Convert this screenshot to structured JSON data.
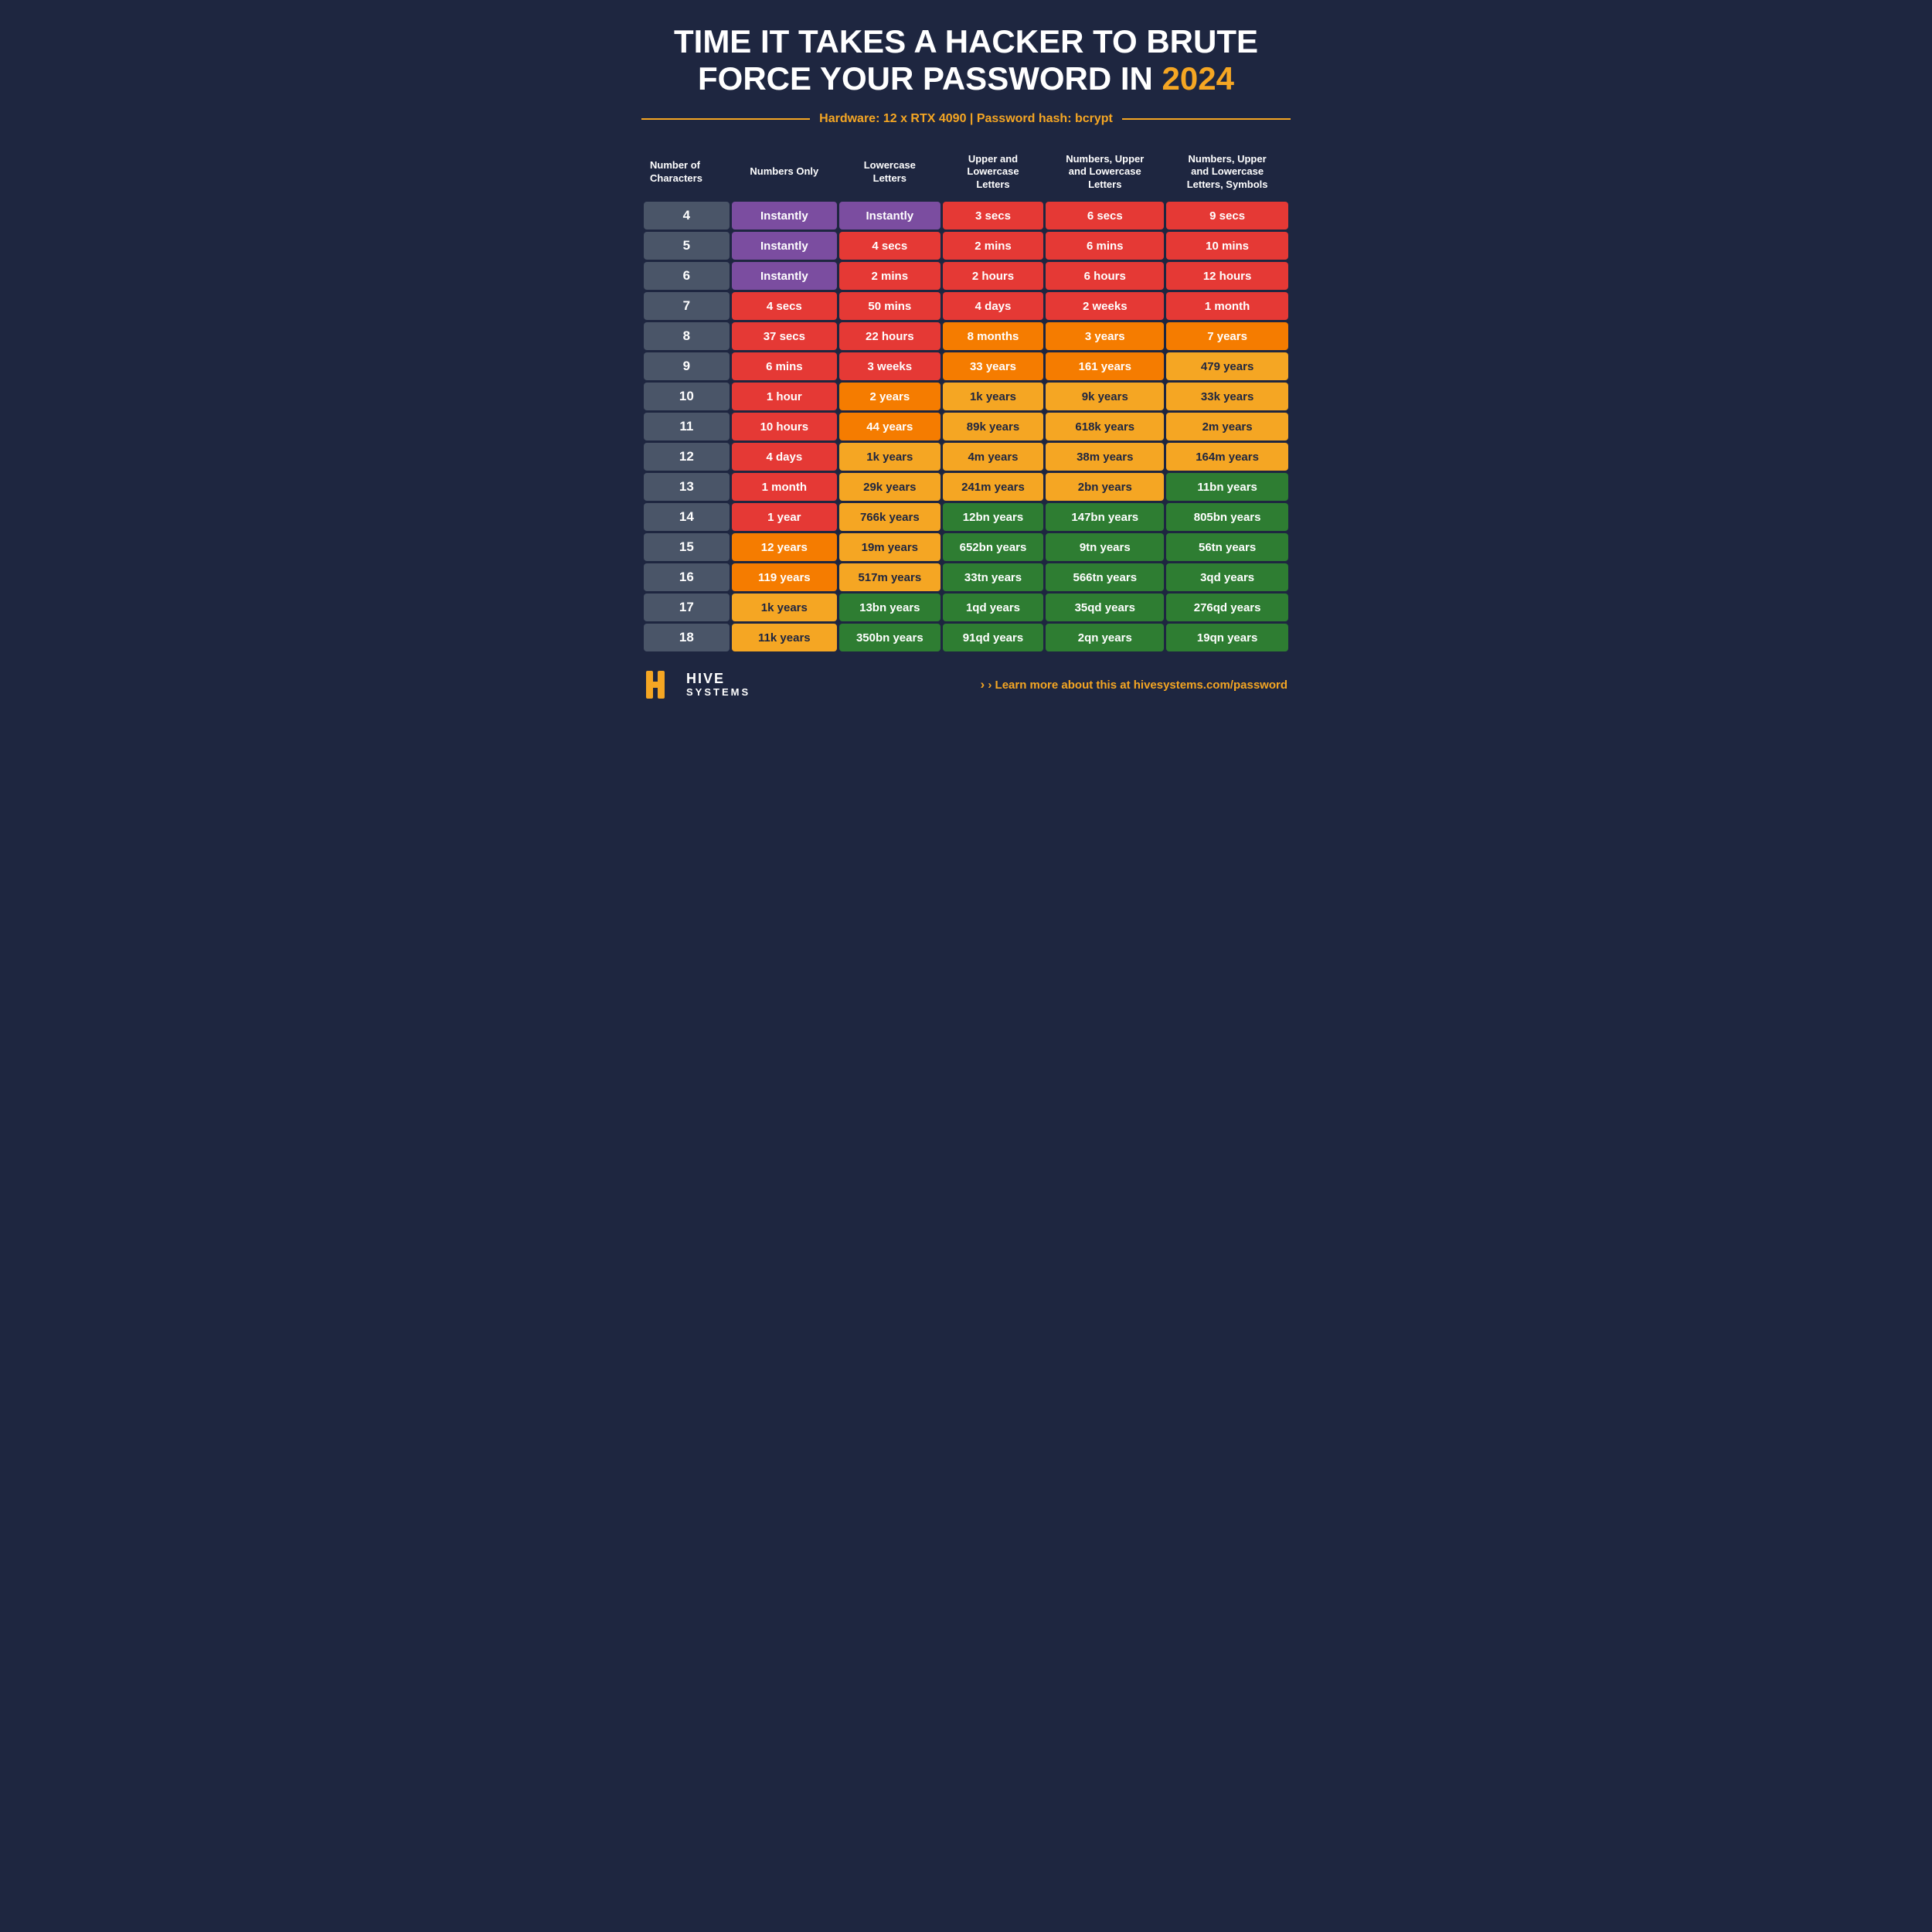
{
  "title": {
    "line1": "TIME IT TAKES A HACKER TO BRUTE",
    "line2": "FORCE YOUR PASSWORD IN",
    "year": "2024"
  },
  "hardware": "Hardware: 12 x RTX 4090  |  Password hash: bcrypt",
  "columns": [
    "Number of\nCharacters",
    "Numbers Only",
    "Lowercase\nLetters",
    "Upper and\nLowercase\nLetters",
    "Numbers, Upper\nand Lowercase\nLetters",
    "Numbers, Upper\nand Lowercase\nLetters, Symbols"
  ],
  "rows": [
    {
      "chars": "4",
      "c1": "Instantly",
      "c1c": "purple",
      "c2": "Instantly",
      "c2c": "purple",
      "c3": "3 secs",
      "c3c": "red",
      "c4": "6 secs",
      "c4c": "red",
      "c5": "9 secs",
      "c5c": "red"
    },
    {
      "chars": "5",
      "c1": "Instantly",
      "c1c": "purple",
      "c2": "4 secs",
      "c2c": "red",
      "c3": "2 mins",
      "c3c": "red",
      "c4": "6 mins",
      "c4c": "red",
      "c5": "10 mins",
      "c5c": "red"
    },
    {
      "chars": "6",
      "c1": "Instantly",
      "c1c": "purple",
      "c2": "2 mins",
      "c2c": "red",
      "c3": "2 hours",
      "c3c": "red",
      "c4": "6 hours",
      "c4c": "red",
      "c5": "12 hours",
      "c5c": "red"
    },
    {
      "chars": "7",
      "c1": "4 secs",
      "c1c": "red",
      "c2": "50 mins",
      "c2c": "red",
      "c3": "4 days",
      "c3c": "red",
      "c4": "2 weeks",
      "c4c": "red",
      "c5": "1 month",
      "c5c": "red"
    },
    {
      "chars": "8",
      "c1": "37 secs",
      "c1c": "red",
      "c2": "22 hours",
      "c2c": "red",
      "c3": "8 months",
      "c3c": "orange",
      "c4": "3 years",
      "c4c": "orange",
      "c5": "7 years",
      "c5c": "orange"
    },
    {
      "chars": "9",
      "c1": "6 mins",
      "c1c": "red",
      "c2": "3 weeks",
      "c2c": "red",
      "c3": "33 years",
      "c3c": "orange",
      "c4": "161 years",
      "c4c": "orange",
      "c5": "479 years",
      "c5c": "yellow"
    },
    {
      "chars": "10",
      "c1": "1 hour",
      "c1c": "red",
      "c2": "2 years",
      "c2c": "orange",
      "c3": "1k years",
      "c3c": "yellow",
      "c4": "9k years",
      "c4c": "yellow",
      "c5": "33k years",
      "c5c": "yellow"
    },
    {
      "chars": "11",
      "c1": "10 hours",
      "c1c": "red",
      "c2": "44 years",
      "c2c": "orange",
      "c3": "89k years",
      "c3c": "yellow",
      "c4": "618k years",
      "c4c": "yellow",
      "c5": "2m years",
      "c5c": "yellow"
    },
    {
      "chars": "12",
      "c1": "4 days",
      "c1c": "red",
      "c2": "1k years",
      "c2c": "yellow",
      "c3": "4m years",
      "c3c": "yellow",
      "c4": "38m years",
      "c4c": "yellow",
      "c5": "164m years",
      "c5c": "yellow"
    },
    {
      "chars": "13",
      "c1": "1 month",
      "c1c": "red",
      "c2": "29k years",
      "c2c": "yellow",
      "c3": "241m years",
      "c3c": "yellow",
      "c4": "2bn years",
      "c4c": "yellow",
      "c5": "11bn years",
      "c5c": "green"
    },
    {
      "chars": "14",
      "c1": "1 year",
      "c1c": "red",
      "c2": "766k years",
      "c2c": "yellow",
      "c3": "12bn years",
      "c3c": "green",
      "c4": "147bn years",
      "c4c": "green",
      "c5": "805bn years",
      "c5c": "green"
    },
    {
      "chars": "15",
      "c1": "12 years",
      "c1c": "orange",
      "c2": "19m years",
      "c2c": "yellow",
      "c3": "652bn years",
      "c3c": "green",
      "c4": "9tn years",
      "c4c": "green",
      "c5": "56tn years",
      "c5c": "green"
    },
    {
      "chars": "16",
      "c1": "119 years",
      "c1c": "orange",
      "c2": "517m years",
      "c2c": "yellow",
      "c3": "33tn years",
      "c3c": "green",
      "c4": "566tn years",
      "c4c": "green",
      "c5": "3qd years",
      "c5c": "green"
    },
    {
      "chars": "17",
      "c1": "1k years",
      "c1c": "yellow",
      "c2": "13bn years",
      "c2c": "green",
      "c3": "1qd years",
      "c3c": "green",
      "c4": "35qd years",
      "c4c": "green",
      "c5": "276qd years",
      "c5c": "green"
    },
    {
      "chars": "18",
      "c1": "11k years",
      "c1c": "yellow",
      "c2": "350bn years",
      "c2c": "green",
      "c3": "91qd years",
      "c3c": "green",
      "c4": "2qn years",
      "c4c": "green",
      "c5": "19qn years",
      "c5c": "green"
    }
  ],
  "footer": {
    "link_prefix": "› Learn more about this at ",
    "link_url": "hivesystems.com/password"
  },
  "colors": {
    "purple": "#7b4da0",
    "red": "#e53935",
    "orange": "#f57c00",
    "yellow": "#f5a623",
    "green": "#2e7d32",
    "bg": "#1e2640",
    "row_char_bg": "#4a5568"
  }
}
